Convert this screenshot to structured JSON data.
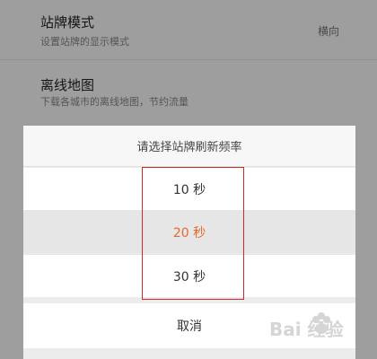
{
  "settings": {
    "row1": {
      "title": "站牌模式",
      "subtitle": "设置站牌的显示模式",
      "value": "横向"
    },
    "row2": {
      "title": "离线地图",
      "subtitle": "下载各城市的离线地图，节约流量"
    }
  },
  "sheet": {
    "title": "请选择站牌刷新频率",
    "options": [
      {
        "label": "10 秒",
        "selected": false
      },
      {
        "label": "20 秒",
        "selected": true
      },
      {
        "label": "30 秒",
        "selected": false
      }
    ],
    "cancel": "取消"
  },
  "watermark": {
    "text": "Bai 经验"
  },
  "colors": {
    "selected": "#e36b27",
    "highlight": "#cc2a2a"
  }
}
